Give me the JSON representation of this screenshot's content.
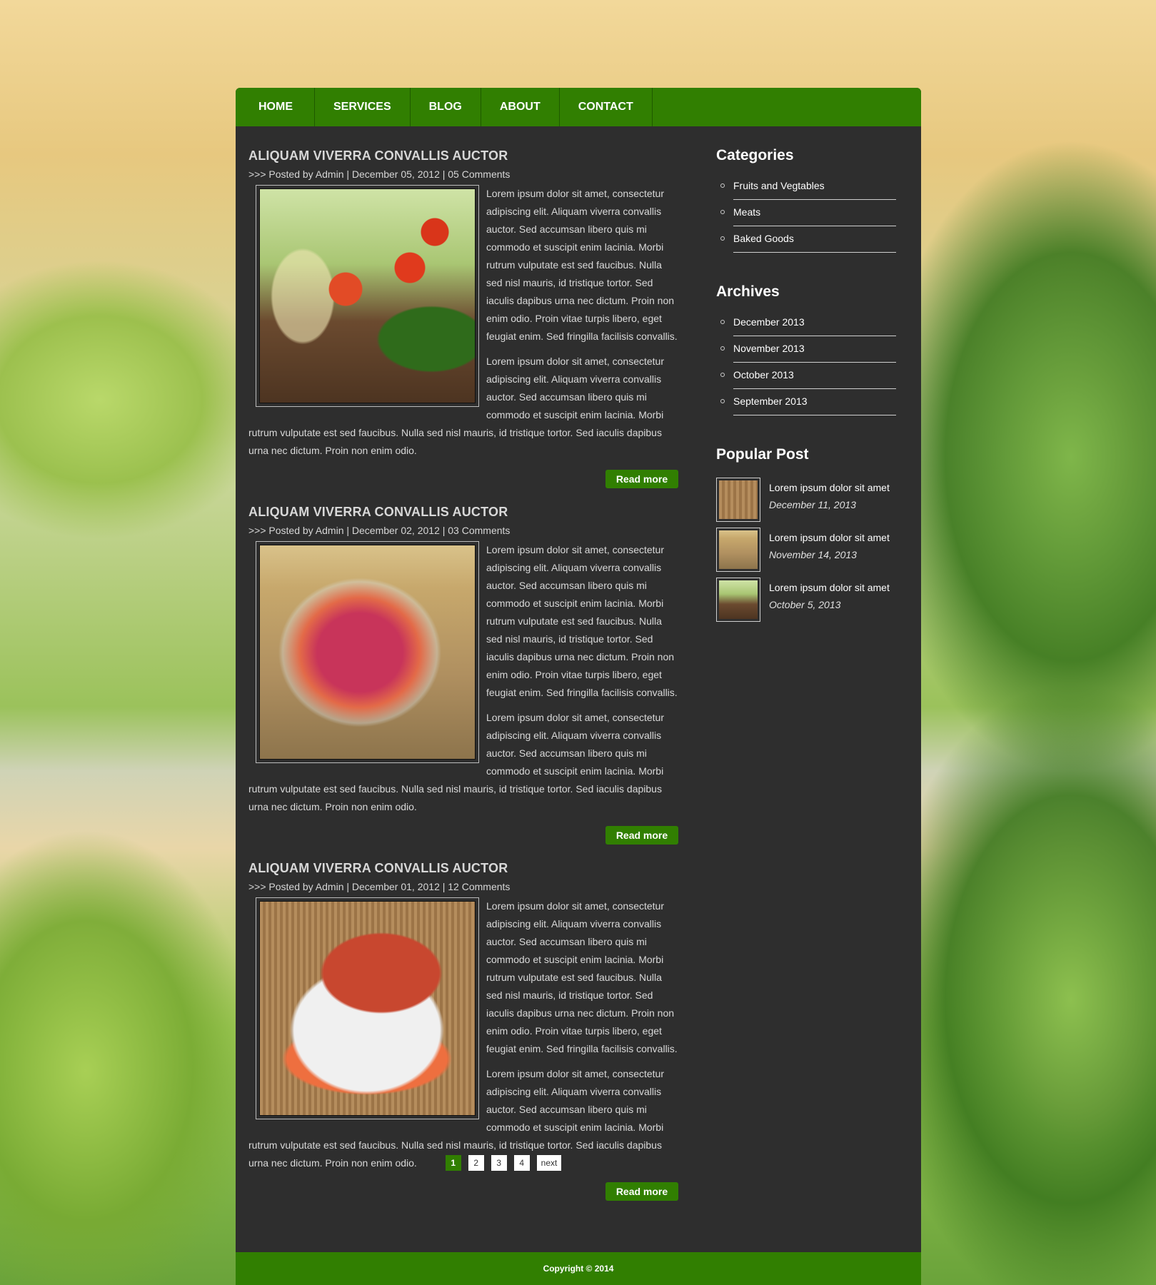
{
  "nav": {
    "items": [
      {
        "label": "HOME"
      },
      {
        "label": "SERVICES"
      },
      {
        "label": "BLOG"
      },
      {
        "label": "ABOUT"
      },
      {
        "label": "CONTACT"
      }
    ]
  },
  "posts": [
    {
      "title": "ALIQUAM VIVERRA CONVALLIS AUCTOR",
      "meta": ">>> Posted by Admin | December 05, 2012 | 05 Comments",
      "p1": "Lorem ipsum dolor sit amet, consectetur adipiscing elit. Aliquam viverra convallis auctor. Sed accumsan libero quis mi commodo et suscipit enim lacinia. Morbi rutrum vulputate est sed faucibus. Nulla sed nisl mauris, id tristique tortor. Sed iaculis dapibus urna nec dictum. Proin non enim odio. Proin vitae turpis libero, eget feugiat enim. Sed fringilla facilisis convallis.",
      "p2": "Lorem ipsum dolor sit amet, consectetur adipiscing elit. Aliquam viverra convallis auctor. Sed accumsan libero quis mi commodo et suscipit enim lacinia. Morbi rutrum vulputate est sed faucibus. Nulla sed nisl mauris, id tristique tortor. Sed iaculis dapibus urna nec dictum. Proin non enim odio.",
      "read_more": "Read more"
    },
    {
      "title": "ALIQUAM VIVERRA CONVALLIS AUCTOR",
      "meta": ">>> Posted by Admin | December 02, 2012 | 03 Comments",
      "p1": "Lorem ipsum dolor sit amet, consectetur adipiscing elit. Aliquam viverra convallis auctor. Sed accumsan libero quis mi commodo et suscipit enim lacinia. Morbi rutrum vulputate est sed faucibus. Nulla sed nisl mauris, id tristique tortor. Sed iaculis dapibus urna nec dictum. Proin non enim odio. Proin vitae turpis libero, eget feugiat enim. Sed fringilla facilisis convallis.",
      "p2": "Lorem ipsum dolor sit amet, consectetur adipiscing elit. Aliquam viverra convallis auctor. Sed accumsan libero quis mi commodo et suscipit enim lacinia. Morbi rutrum vulputate est sed faucibus. Nulla sed nisl mauris, id tristique tortor. Sed iaculis dapibus urna nec dictum. Proin non enim odio.",
      "read_more": "Read more"
    },
    {
      "title": "ALIQUAM VIVERRA CONVALLIS AUCTOR",
      "meta": ">>> Posted by Admin | December 01, 2012 | 12 Comments",
      "p1": "Lorem ipsum dolor sit amet, consectetur adipiscing elit. Aliquam viverra convallis auctor. Sed accumsan libero quis mi commodo et suscipit enim lacinia. Morbi rutrum vulputate est sed faucibus. Nulla sed nisl mauris, id tristique tortor. Sed iaculis dapibus urna nec dictum. Proin non enim odio. Proin vitae turpis libero, eget feugiat enim. Sed fringilla facilisis convallis.",
      "p2": "Lorem ipsum dolor sit amet, consectetur adipiscing elit. Aliquam viverra convallis auctor. Sed accumsan libero quis mi commodo et suscipit enim lacinia. Morbi rutrum vulputate est sed faucibus. Nulla sed nisl mauris, id tristique tortor. Sed iaculis dapibus urna nec dictum. Proin non enim odio.",
      "read_more": "Read more"
    }
  ],
  "sidebar": {
    "categories_title": "Categories",
    "categories": [
      "Fruits and Vegtables",
      "Meats",
      "Baked Goods"
    ],
    "archives_title": "Archives",
    "archives": [
      "December 2013",
      "November 2013",
      "October 2013",
      "September 2013"
    ],
    "popular_title": "Popular Post",
    "popular": [
      {
        "title": "Lorem ipsum dolor sit amet",
        "date": "December 11, 2013"
      },
      {
        "title": "Lorem ipsum dolor sit amet",
        "date": "November 14, 2013"
      },
      {
        "title": "Lorem ipsum dolor sit amet",
        "date": "October 5, 2013"
      }
    ]
  },
  "pagination": {
    "pages": [
      "1",
      "2",
      "3",
      "4"
    ],
    "next": "next",
    "current": "1"
  },
  "footer": {
    "copyright": "Copyright © 2014"
  },
  "colors": {
    "accent": "#317f01",
    "panel": "#2e2e2e"
  }
}
